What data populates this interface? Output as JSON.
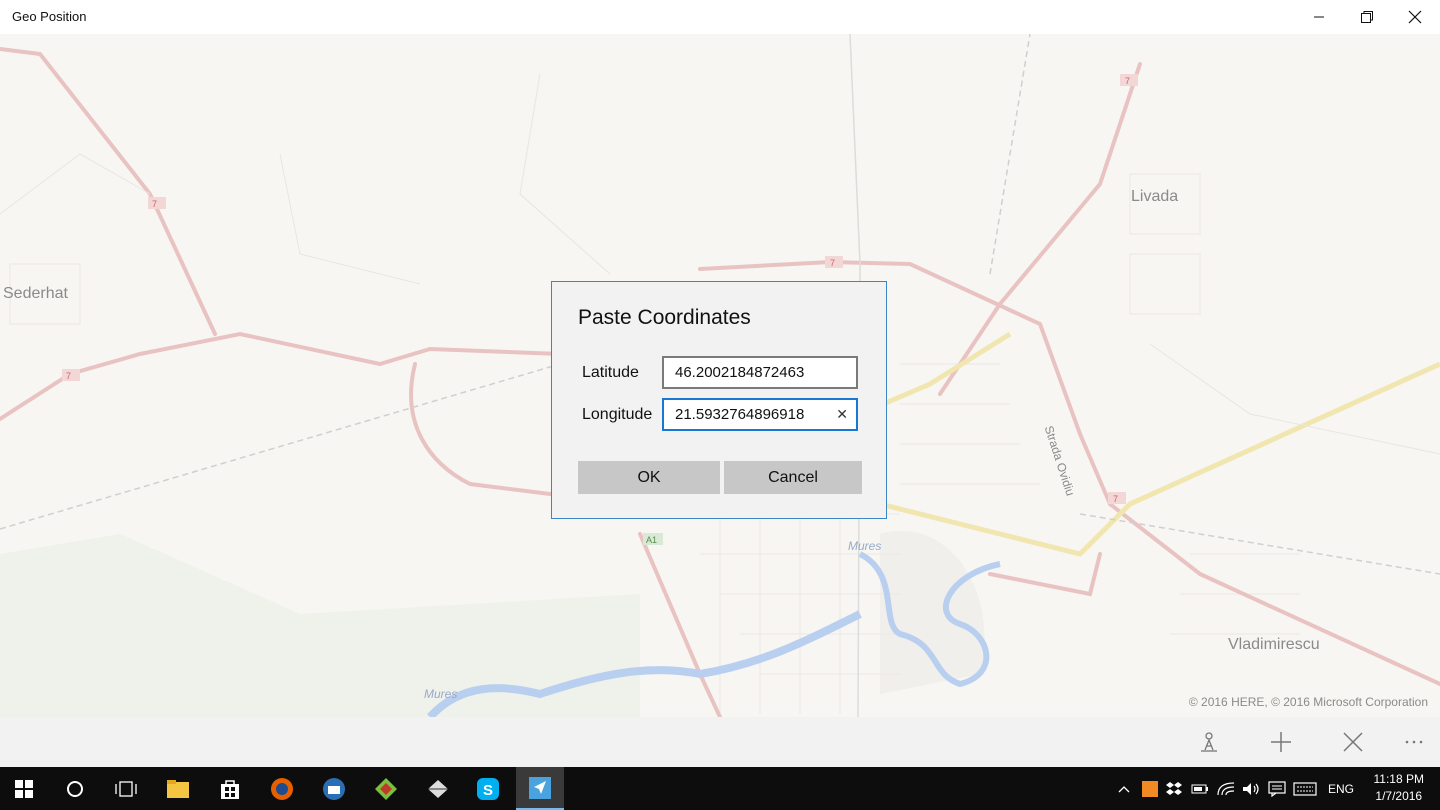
{
  "window": {
    "title": "Geo Position"
  },
  "map": {
    "labels": {
      "sederhat": "Sederhat",
      "livada": "Livada",
      "vladimirescu": "Vladimirescu",
      "mures1": "Mures",
      "mures2": "Mures",
      "strada": "Strada Ovidiu"
    },
    "road_shields": {
      "a1": "A1",
      "seven_a": "7",
      "seven_b": "7",
      "seven_c": "7",
      "seven_d": "7",
      "seven_e": "7"
    },
    "copyright": "© 2016 HERE, © 2016 Microsoft Corporation"
  },
  "dialog": {
    "title": "Paste Coordinates",
    "latitude_label": "Latitude",
    "latitude_value": "46.2002184872463",
    "longitude_label": "Longitude",
    "longitude_value": "21.5932764896918",
    "ok_label": "OK",
    "cancel_label": "Cancel"
  },
  "appbar": {
    "icons": [
      "person-location-icon",
      "add-icon",
      "close-icon",
      "more-icon"
    ]
  },
  "taskbar": {
    "language": "ENG",
    "time": "11:18 PM",
    "date": "1/7/2016"
  },
  "colors": {
    "accent": "#1976d2",
    "dialog_border": "#3d86c6",
    "taskbar": "#0d0d0d",
    "road": "#e9c2c2",
    "river": "#b9cff0"
  }
}
